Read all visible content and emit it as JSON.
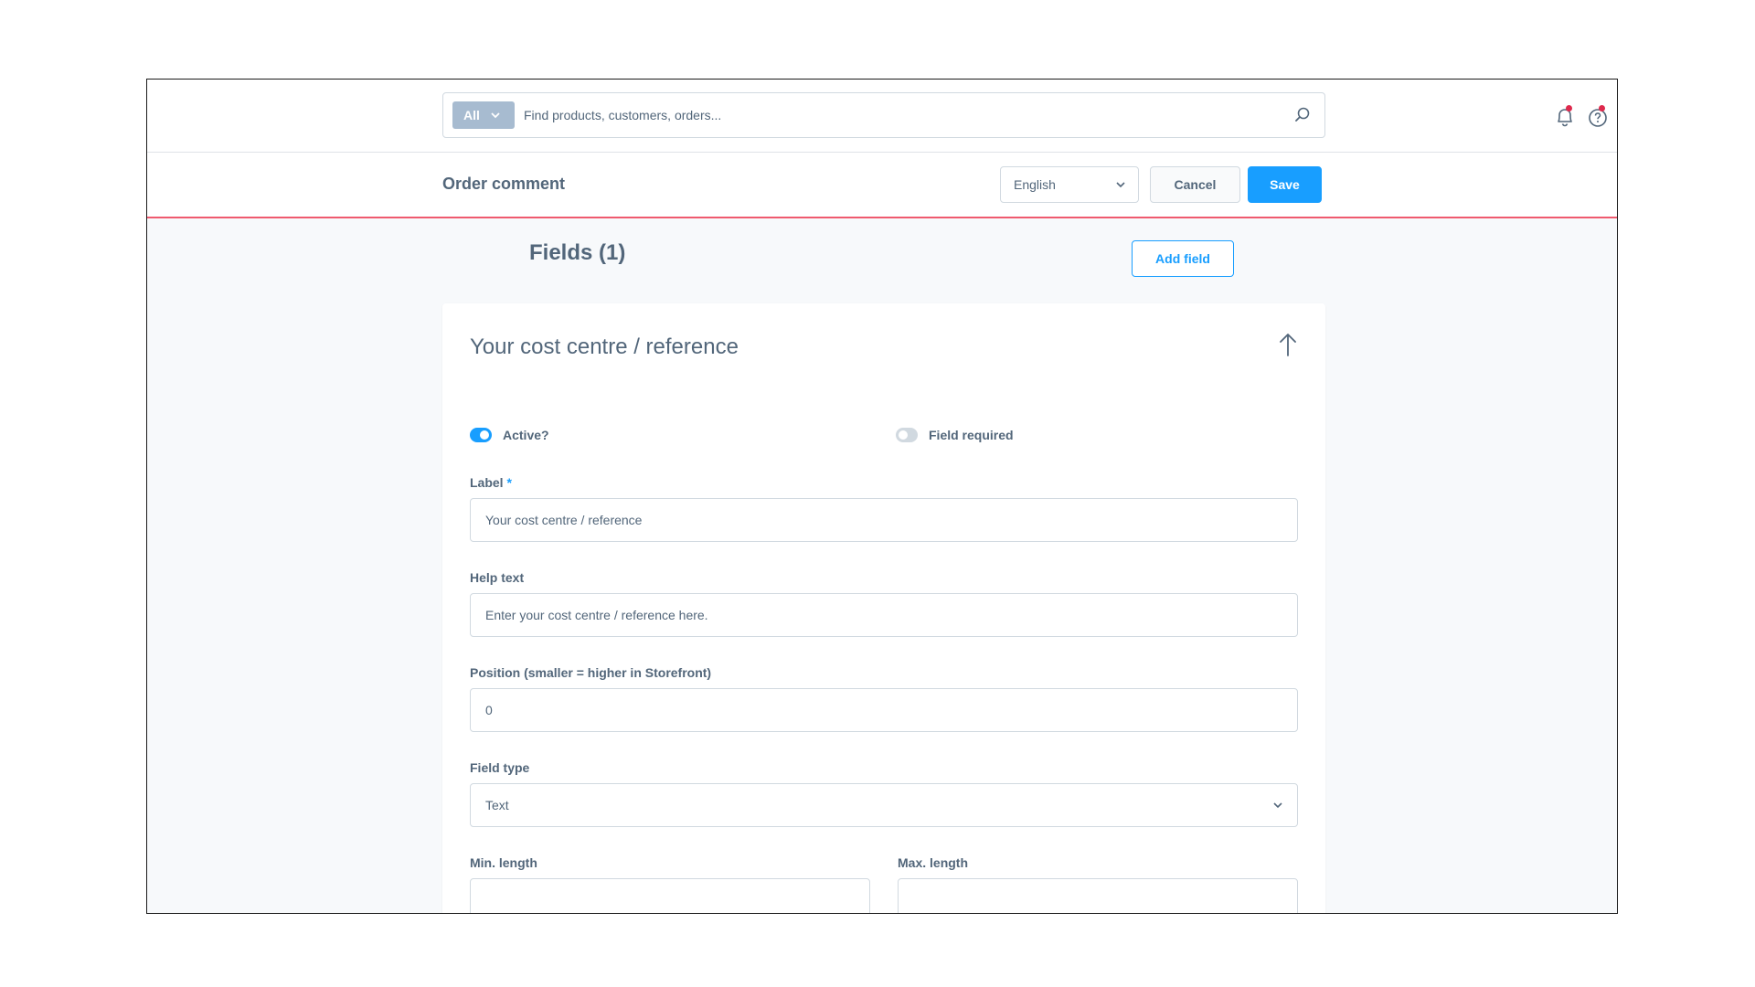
{
  "header": {
    "search_type": "All",
    "search_placeholder": "Find products, customers, orders...",
    "bell_icon": "bell-icon",
    "help_icon": "help-icon",
    "notification_color": "#de294c"
  },
  "smartbar": {
    "title": "Order comment",
    "language": "English",
    "cancel_label": "Cancel",
    "save_label": "Save",
    "accent_color": "#189eff",
    "divider_color": "#ef5a6f"
  },
  "content": {
    "fields_title": "Fields (1)",
    "add_field_label": "Add field"
  },
  "field_card": {
    "title": "Your cost centre / reference",
    "active": {
      "label": "Active?",
      "on": true
    },
    "required": {
      "label": "Field required",
      "on": false
    },
    "label_field": {
      "label": "Label",
      "required_marker": "*",
      "value": "Your cost centre / reference"
    },
    "help_text": {
      "label": "Help text",
      "value": "Enter your cost centre / reference here."
    },
    "position": {
      "label": "Position (smaller = higher in Storefront)",
      "value": "0"
    },
    "field_type": {
      "label": "Field type",
      "value": "Text"
    },
    "min_length": {
      "label": "Min. length",
      "value": ""
    },
    "max_length": {
      "label": "Max. length",
      "value": ""
    }
  }
}
